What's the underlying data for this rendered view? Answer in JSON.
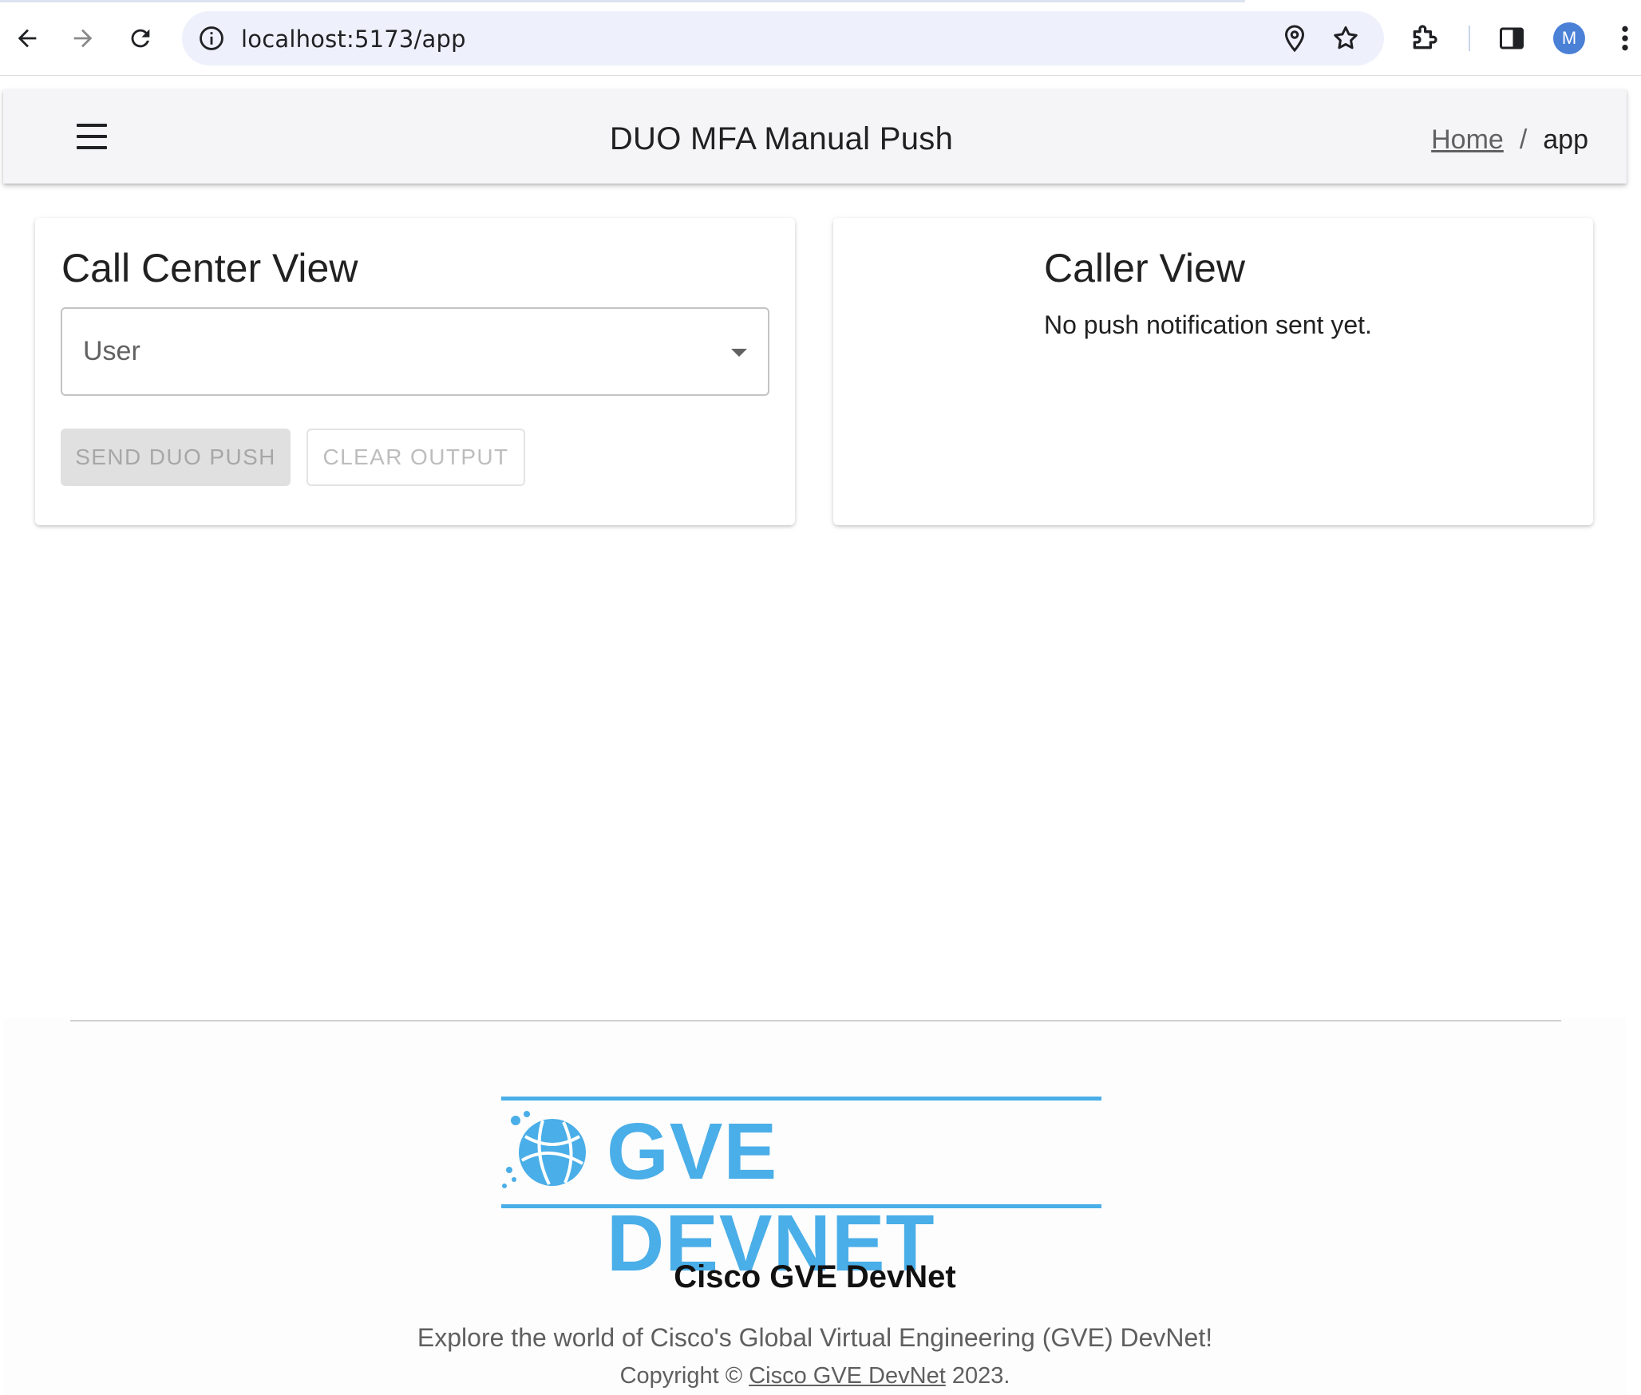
{
  "browser": {
    "url": "localhost:5173/app",
    "profile_initial": "M"
  },
  "header": {
    "title": "DUO MFA Manual Push",
    "breadcrumb": {
      "home": "Home",
      "separator": "/",
      "current": "app"
    }
  },
  "call_center": {
    "title": "Call Center View",
    "user_select_placeholder": "User",
    "send_button": "SEND DUO PUSH",
    "clear_button": "CLEAR OUTPUT"
  },
  "caller": {
    "title": "Caller View",
    "status": "No push notification sent yet."
  },
  "footer": {
    "logo_text": "GVE DEVNET",
    "name": "Cisco GVE DevNet",
    "description": "Explore the world of Cisco's Global Virtual Engineering (GVE) DevNet!",
    "copyright_prefix": "Copyright ©",
    "copyright_link": "Cisco GVE DevNet",
    "copyright_year": "2023."
  },
  "colors": {
    "logo_blue": "#4aaee8",
    "app_bar_bg": "#f5f5f8",
    "disabled_text": "#a7a7a7"
  }
}
